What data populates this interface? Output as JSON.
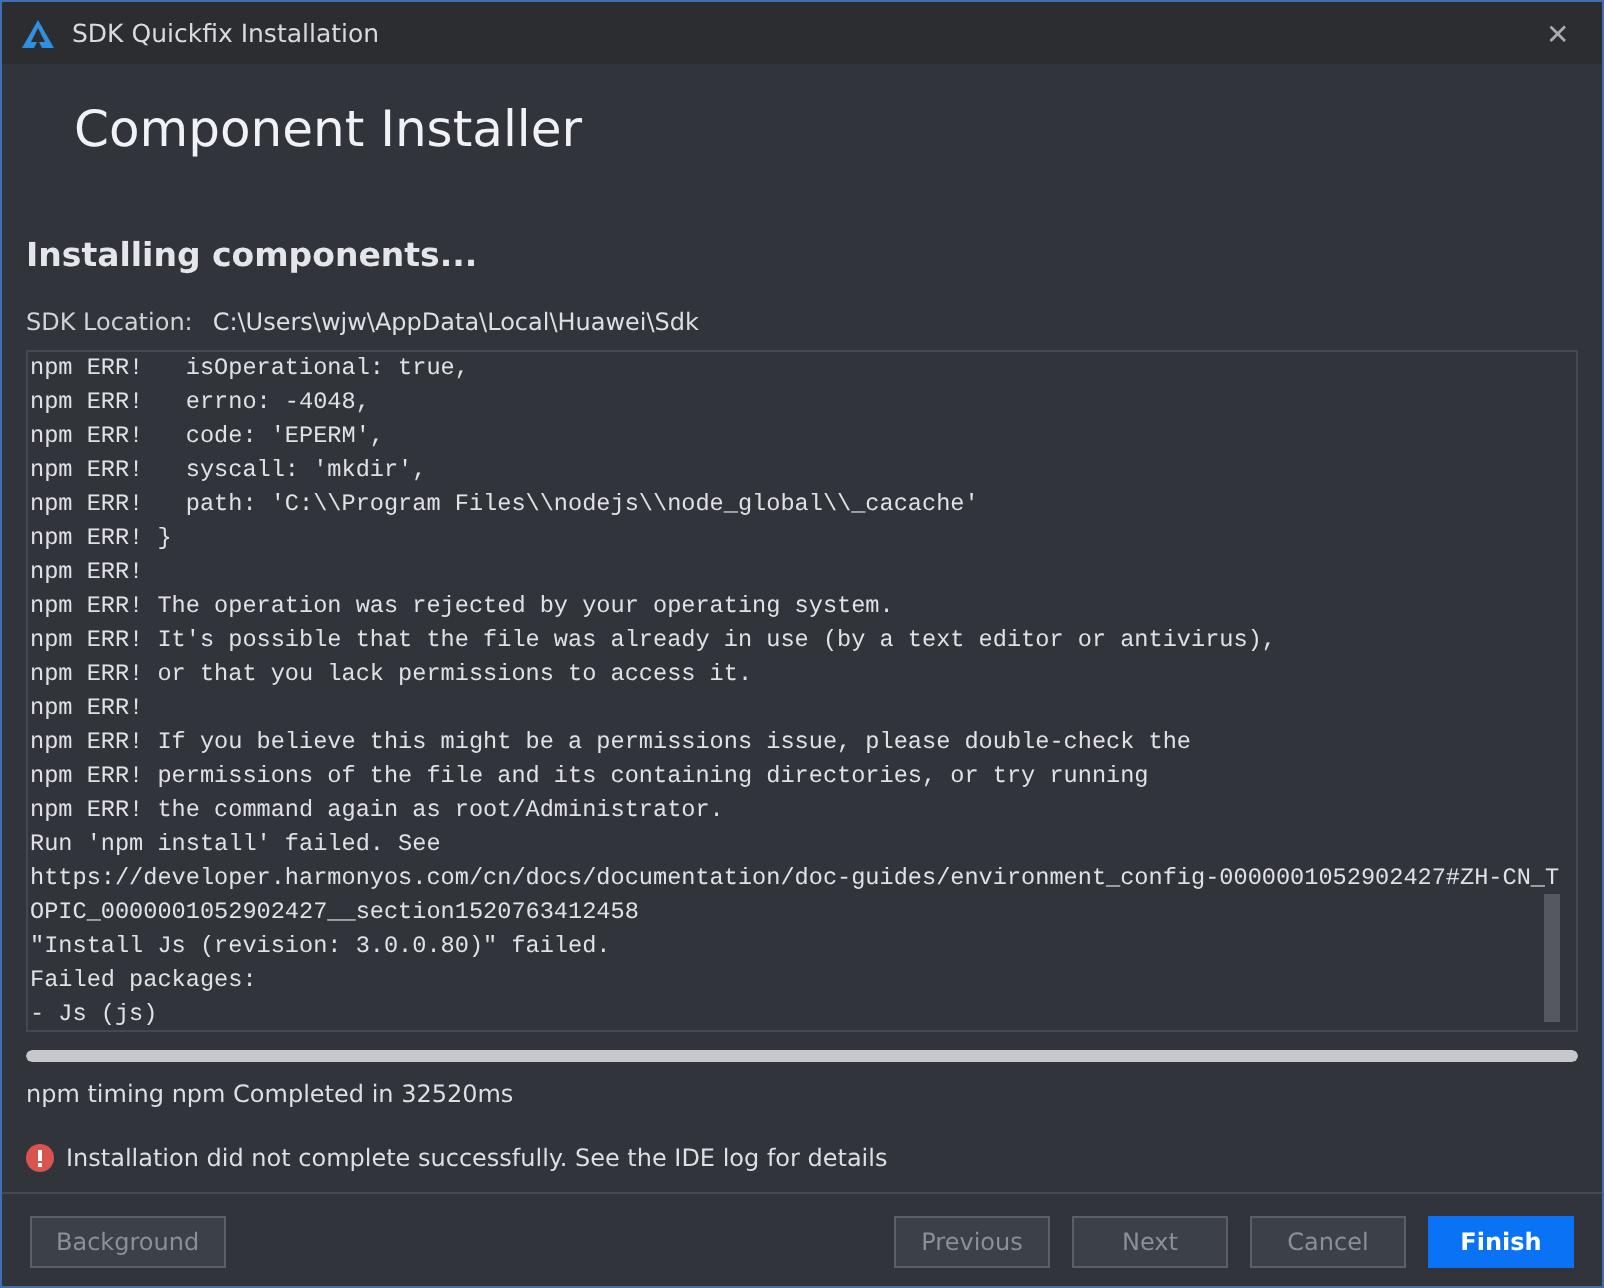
{
  "window": {
    "title": "SDK Quickfix Installation",
    "close": "✕"
  },
  "header": "Component Installer",
  "section_title": "Installing components...",
  "sdk_location": {
    "label": "SDK Location:",
    "value": "C:\\Users\\wjw\\AppData\\Local\\Huawei\\Sdk"
  },
  "log_lines": [
    "npm ERR!   isOperational: true,",
    "npm ERR!   errno: -4048,",
    "npm ERR!   code: 'EPERM',",
    "npm ERR!   syscall: 'mkdir',",
    "npm ERR!   path: 'C:\\\\Program Files\\\\nodejs\\\\node_global\\\\_cacache'",
    "npm ERR! }",
    "npm ERR!",
    "npm ERR! The operation was rejected by your operating system.",
    "npm ERR! It's possible that the file was already in use (by a text editor or antivirus),",
    "npm ERR! or that you lack permissions to access it.",
    "npm ERR!",
    "npm ERR! If you believe this might be a permissions issue, please double-check the",
    "npm ERR! permissions of the file and its containing directories, or try running",
    "npm ERR! the command again as root/Administrator.",
    "Run 'npm install' failed. See",
    "https://developer.harmonyos.com/cn/docs/documentation/doc-guides/environment_config-0000001052902427#ZH-CN_T",
    "OPIC_0000001052902427__section1520763412458",
    "\"Install Js (revision: 3.0.0.80)\" failed.",
    "Failed packages:",
    "- Js (js)"
  ],
  "progress": {
    "level": 1
  },
  "status_text": "npm timing npm Completed in 32520ms",
  "error_message": "Installation did not complete successfully. See the IDE log for details",
  "left_buttons": [
    {
      "label": "Background",
      "disabled": true,
      "primary": false
    }
  ],
  "buttons": [
    {
      "label": "Previous",
      "disabled": true,
      "primary": false
    },
    {
      "label": "Next",
      "disabled": true,
      "primary": false
    },
    {
      "label": "Cancel",
      "disabled": true,
      "primary": false
    },
    {
      "label": "Finish",
      "disabled": false,
      "primary": true
    }
  ]
}
